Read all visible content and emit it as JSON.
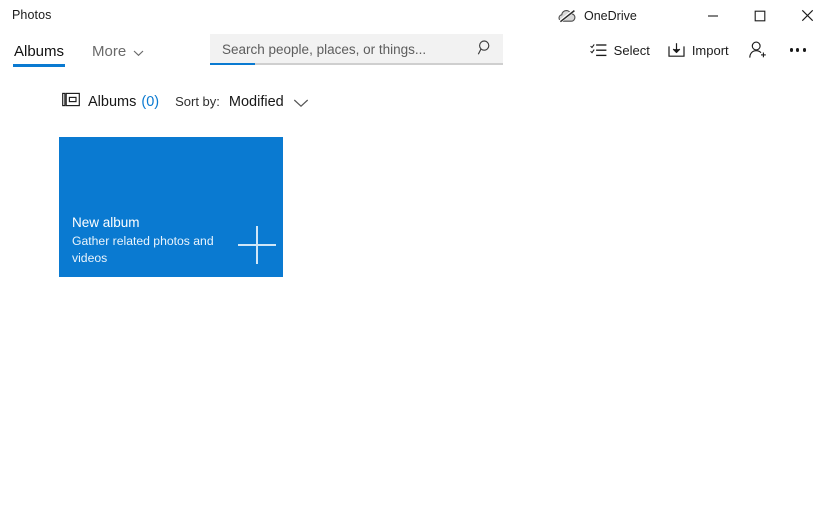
{
  "window": {
    "app_title": "Photos",
    "onedrive_label": "OneDrive",
    "onedrive_icon": "cloud-off-icon",
    "minimize_icon": "minimize-icon",
    "maximize_icon": "maximize-icon",
    "close_icon": "close-icon"
  },
  "commandbar": {
    "tabs": [
      {
        "label": "Albums",
        "active": true
      },
      {
        "label": "More",
        "active": false,
        "icon": "chevron-down-icon"
      }
    ],
    "search": {
      "placeholder": "Search people, places, or things...",
      "value": "",
      "icon": "search-icon"
    },
    "actions": [
      {
        "label": "Select",
        "icon": "select-checklist-icon"
      },
      {
        "label": "Import",
        "icon": "import-icon"
      },
      {
        "label": "",
        "icon": "add-person-icon"
      },
      {
        "label": "",
        "icon": "more-dots-icon"
      }
    ]
  },
  "subheader": {
    "albums_icon": "album-icon",
    "albums_label": "Albums",
    "albums_count": "(0)",
    "sort_by_label": "Sort by:",
    "sort_by_value": "Modified",
    "sort_chevron_icon": "chevron-down-icon"
  },
  "new_album_tile": {
    "title": "New album",
    "subtitle": "Gather related photos and videos",
    "plus_icon": "plus-icon"
  },
  "colors": {
    "accent_blue": "#0a7ad1",
    "tile_blue": "#0a7ad1",
    "search_bg": "#f2f2f2",
    "text_primary": "#1b1b1b",
    "text_muted": "#6a6a6a"
  }
}
